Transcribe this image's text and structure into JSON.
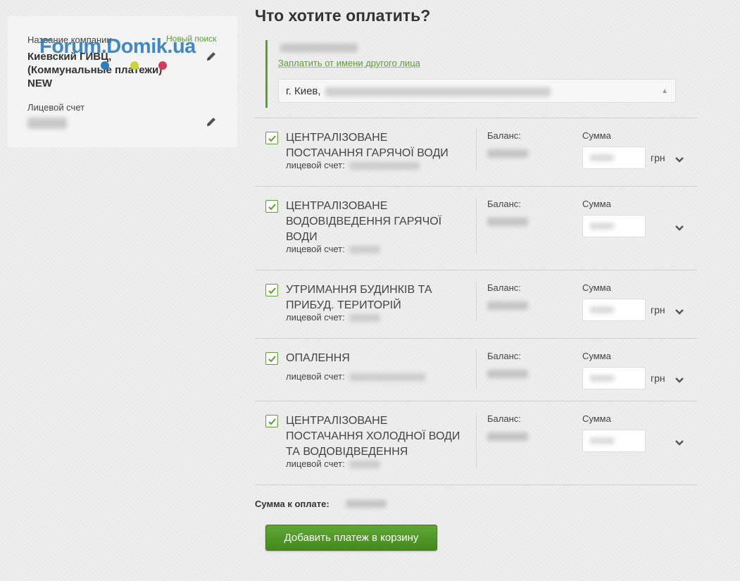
{
  "company_card": {
    "company_label": "Название компании",
    "new_search": "Новый поиск",
    "company_name": "Киевский ГИВЦ,\n(Коммунальные платежи)\nNEW",
    "account_label": "Лицевой счет"
  },
  "watermark": "Forum.Domik.ua",
  "main": {
    "title": "Что хотите оплатить?",
    "other_payer_link": "Заплатить от имени другого лица",
    "address_prefix": "г. Киев,"
  },
  "labels": {
    "account": "лицевой счет:",
    "balance": "Баланс:",
    "sum": "Сумма",
    "currency": "грн"
  },
  "services": [
    {
      "name": "ЦЕНТРАЛІЗОВАНЕ ПОСТАЧАННЯ ГАРЯЧОЇ ВОДИ",
      "checked": true,
      "currency_visible": true
    },
    {
      "name": "ЦЕНТРАЛІЗОВАНЕ ВОДОВІДВЕДЕННЯ ГАРЯЧОЇ ВОДИ",
      "checked": true,
      "currency_visible": false
    },
    {
      "name": "УТРИМАННЯ БУДИНКІВ ТА ПРИБУД. ТЕРИТОРІЙ",
      "checked": true,
      "currency_visible": true
    },
    {
      "name": "ОПАЛЕННЯ",
      "checked": true,
      "currency_visible": true
    },
    {
      "name": "ЦЕНТРАЛІЗОВАНЕ ПОСТАЧАННЯ ХОЛОДНОЇ ВОДИ ТА ВОДОВІДВЕДЕННЯ",
      "checked": true,
      "currency_visible": false
    }
  ],
  "total_label": "Сумма к оплате:",
  "add_button": "Добавить платеж в корзину",
  "colors": {
    "accent": "#5aa02c",
    "watermark": "#2f7dc1"
  },
  "icons": {
    "edit": "pencil-icon",
    "checkbox": "checkmark-icon",
    "expand": "chevron-down-icon"
  }
}
